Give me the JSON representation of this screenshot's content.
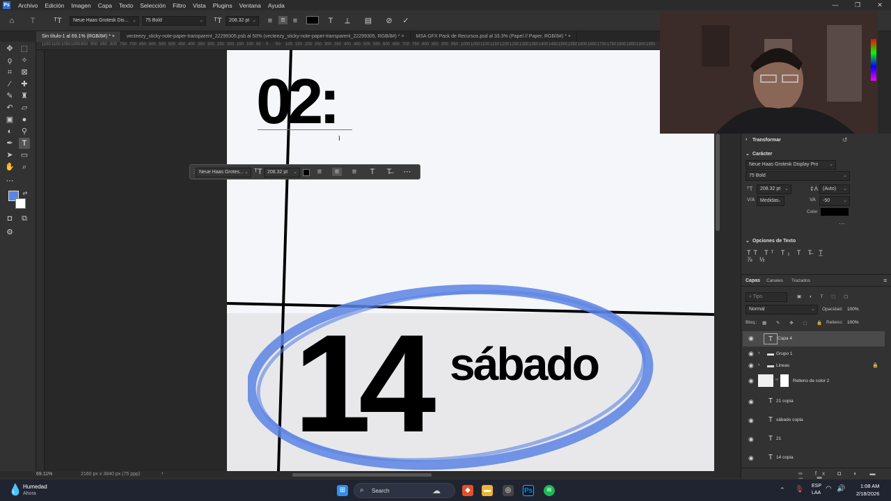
{
  "app": {
    "logo": "Ps"
  },
  "menu": [
    "Archivo",
    "Edición",
    "Imagen",
    "Capa",
    "Texto",
    "Selección",
    "Filtro",
    "Vista",
    "Plugins",
    "Ventana",
    "Ayuda"
  ],
  "window_controls": {
    "minimize": "—",
    "maximize": "❐",
    "close": "✕"
  },
  "options_bar": {
    "font_family": "Neue Haas Grotesk Dis...",
    "font_style": "75 Bold",
    "font_size": "208.32 pt",
    "text_color": "#000000"
  },
  "tabs": [
    {
      "label": "Sin título-1 al 69.1% (RGB/8#) *",
      "active": true
    },
    {
      "label": "vecteezy_sticky-note-paper-transparent_22299305.psb al 50% (vecteezy_sticky-note-paper-transparent_22299305, RGB/8#) *",
      "active": false
    },
    {
      "label": "MSA GFX Pack de Recursos.psd al 33.3% (Papel // Paper, RGB/8#) *",
      "active": false
    }
  ],
  "ruler_top": [
    "1150",
    "1100",
    "1050",
    "1000",
    "950",
    "900",
    "850",
    "800",
    "750",
    "700",
    "650",
    "600",
    "550",
    "500",
    "450",
    "400",
    "350",
    "300",
    "250",
    "200",
    "150",
    "100",
    "50",
    "0",
    "50",
    "100",
    "150",
    "200",
    "250",
    "300",
    "350",
    "400",
    "450",
    "500",
    "550",
    "600",
    "650",
    "700",
    "750",
    "800",
    "850",
    "900",
    "950",
    "1000",
    "1050",
    "1100",
    "1150",
    "1200",
    "1250",
    "1300",
    "1350",
    "1400",
    "1450",
    "1500",
    "1550",
    "1600",
    "1650",
    "1700",
    "1750",
    "1800",
    "1850",
    "1900",
    "1950"
  ],
  "canvas": {
    "time_text": "02:",
    "day_number": "14",
    "day_name": "sábado",
    "circle_color": "#5b84e4"
  },
  "context_bar": {
    "font_family": "Neue Haas Grotes...",
    "font_size": "208.32 pt"
  },
  "status": {
    "zoom": "69.11%",
    "doc_info": "2160 px x 3840 px (75 ppp)"
  },
  "right_panel": {
    "transform_header": "Transformar",
    "character_header": "Carácter",
    "font_family": "Neue Haas Grotesk Display Pro",
    "font_style": "75 Bold",
    "font_size": "208.32 pt",
    "leading": "(Auto)",
    "kerning": "Medidas",
    "tracking": "-50",
    "color_label": "Color",
    "color": "#000000",
    "text_options_header": "Opciones de Texto",
    "layers_tabs": [
      "Capas",
      "Canales",
      "Trazados"
    ],
    "search_placeholder": "Tipo",
    "blend_mode": "Normal",
    "opacity_label": "Opacidad:",
    "opacity": "100%",
    "lock_label": "Bloq.:",
    "fill_label": "Relleno:",
    "fill": "100%",
    "layers": [
      {
        "name": "Capa 4",
        "kind": "text",
        "selected": true
      },
      {
        "name": "Grupo 1",
        "kind": "group",
        "selected": false
      },
      {
        "name": "Lineas",
        "kind": "group",
        "selected": false
      },
      {
        "name": "Relleno de color 2",
        "kind": "fill",
        "selected": false
      },
      {
        "name": "21 copia",
        "kind": "text",
        "selected": false
      },
      {
        "name": "sábado copia",
        "kind": "text",
        "selected": false
      },
      {
        "name": "21",
        "kind": "text",
        "selected": false
      },
      {
        "name": "14 copia",
        "kind": "text",
        "selected": false
      }
    ]
  },
  "taskbar": {
    "weather_title": "Humedad",
    "weather_sub": "Ahora",
    "search_label": "Search",
    "lang_top": "ESP",
    "lang_bottom": "LAA",
    "time": "1:08 AM",
    "date": "2/18/2026"
  }
}
